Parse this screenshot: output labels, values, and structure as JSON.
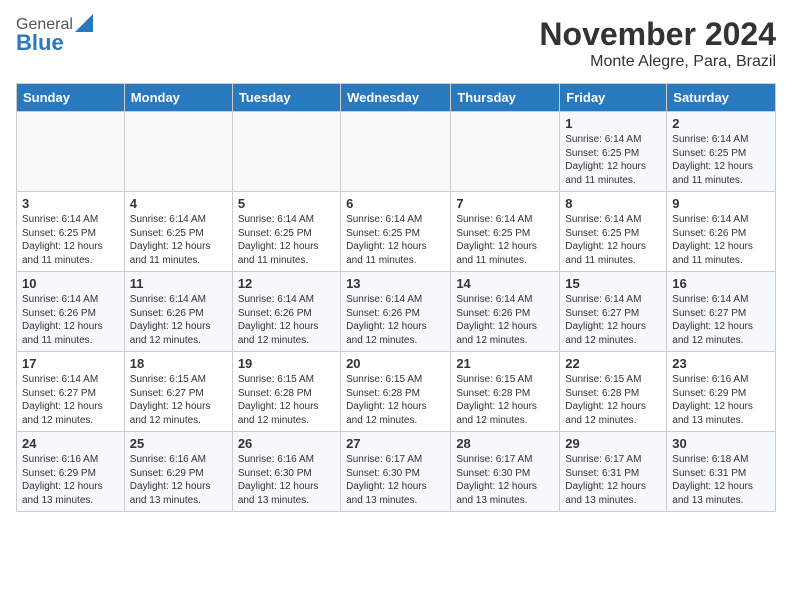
{
  "header": {
    "logo_general": "General",
    "logo_blue": "Blue",
    "title": "November 2024",
    "subtitle": "Monte Alegre, Para, Brazil"
  },
  "calendar": {
    "days_of_week": [
      "Sunday",
      "Monday",
      "Tuesday",
      "Wednesday",
      "Thursday",
      "Friday",
      "Saturday"
    ],
    "weeks": [
      [
        {
          "day": "",
          "info": ""
        },
        {
          "day": "",
          "info": ""
        },
        {
          "day": "",
          "info": ""
        },
        {
          "day": "",
          "info": ""
        },
        {
          "day": "",
          "info": ""
        },
        {
          "day": "1",
          "info": "Sunrise: 6:14 AM\nSunset: 6:25 PM\nDaylight: 12 hours and 11 minutes."
        },
        {
          "day": "2",
          "info": "Sunrise: 6:14 AM\nSunset: 6:25 PM\nDaylight: 12 hours and 11 minutes."
        }
      ],
      [
        {
          "day": "3",
          "info": "Sunrise: 6:14 AM\nSunset: 6:25 PM\nDaylight: 12 hours and 11 minutes."
        },
        {
          "day": "4",
          "info": "Sunrise: 6:14 AM\nSunset: 6:25 PM\nDaylight: 12 hours and 11 minutes."
        },
        {
          "day": "5",
          "info": "Sunrise: 6:14 AM\nSunset: 6:25 PM\nDaylight: 12 hours and 11 minutes."
        },
        {
          "day": "6",
          "info": "Sunrise: 6:14 AM\nSunset: 6:25 PM\nDaylight: 12 hours and 11 minutes."
        },
        {
          "day": "7",
          "info": "Sunrise: 6:14 AM\nSunset: 6:25 PM\nDaylight: 12 hours and 11 minutes."
        },
        {
          "day": "8",
          "info": "Sunrise: 6:14 AM\nSunset: 6:25 PM\nDaylight: 12 hours and 11 minutes."
        },
        {
          "day": "9",
          "info": "Sunrise: 6:14 AM\nSunset: 6:26 PM\nDaylight: 12 hours and 11 minutes."
        }
      ],
      [
        {
          "day": "10",
          "info": "Sunrise: 6:14 AM\nSunset: 6:26 PM\nDaylight: 12 hours and 11 minutes."
        },
        {
          "day": "11",
          "info": "Sunrise: 6:14 AM\nSunset: 6:26 PM\nDaylight: 12 hours and 12 minutes."
        },
        {
          "day": "12",
          "info": "Sunrise: 6:14 AM\nSunset: 6:26 PM\nDaylight: 12 hours and 12 minutes."
        },
        {
          "day": "13",
          "info": "Sunrise: 6:14 AM\nSunset: 6:26 PM\nDaylight: 12 hours and 12 minutes."
        },
        {
          "day": "14",
          "info": "Sunrise: 6:14 AM\nSunset: 6:26 PM\nDaylight: 12 hours and 12 minutes."
        },
        {
          "day": "15",
          "info": "Sunrise: 6:14 AM\nSunset: 6:27 PM\nDaylight: 12 hours and 12 minutes."
        },
        {
          "day": "16",
          "info": "Sunrise: 6:14 AM\nSunset: 6:27 PM\nDaylight: 12 hours and 12 minutes."
        }
      ],
      [
        {
          "day": "17",
          "info": "Sunrise: 6:14 AM\nSunset: 6:27 PM\nDaylight: 12 hours and 12 minutes."
        },
        {
          "day": "18",
          "info": "Sunrise: 6:15 AM\nSunset: 6:27 PM\nDaylight: 12 hours and 12 minutes."
        },
        {
          "day": "19",
          "info": "Sunrise: 6:15 AM\nSunset: 6:28 PM\nDaylight: 12 hours and 12 minutes."
        },
        {
          "day": "20",
          "info": "Sunrise: 6:15 AM\nSunset: 6:28 PM\nDaylight: 12 hours and 12 minutes."
        },
        {
          "day": "21",
          "info": "Sunrise: 6:15 AM\nSunset: 6:28 PM\nDaylight: 12 hours and 12 minutes."
        },
        {
          "day": "22",
          "info": "Sunrise: 6:15 AM\nSunset: 6:28 PM\nDaylight: 12 hours and 12 minutes."
        },
        {
          "day": "23",
          "info": "Sunrise: 6:16 AM\nSunset: 6:29 PM\nDaylight: 12 hours and 13 minutes."
        }
      ],
      [
        {
          "day": "24",
          "info": "Sunrise: 6:16 AM\nSunset: 6:29 PM\nDaylight: 12 hours and 13 minutes."
        },
        {
          "day": "25",
          "info": "Sunrise: 6:16 AM\nSunset: 6:29 PM\nDaylight: 12 hours and 13 minutes."
        },
        {
          "day": "26",
          "info": "Sunrise: 6:16 AM\nSunset: 6:30 PM\nDaylight: 12 hours and 13 minutes."
        },
        {
          "day": "27",
          "info": "Sunrise: 6:17 AM\nSunset: 6:30 PM\nDaylight: 12 hours and 13 minutes."
        },
        {
          "day": "28",
          "info": "Sunrise: 6:17 AM\nSunset: 6:30 PM\nDaylight: 12 hours and 13 minutes."
        },
        {
          "day": "29",
          "info": "Sunrise: 6:17 AM\nSunset: 6:31 PM\nDaylight: 12 hours and 13 minutes."
        },
        {
          "day": "30",
          "info": "Sunrise: 6:18 AM\nSunset: 6:31 PM\nDaylight: 12 hours and 13 minutes."
        }
      ]
    ]
  }
}
